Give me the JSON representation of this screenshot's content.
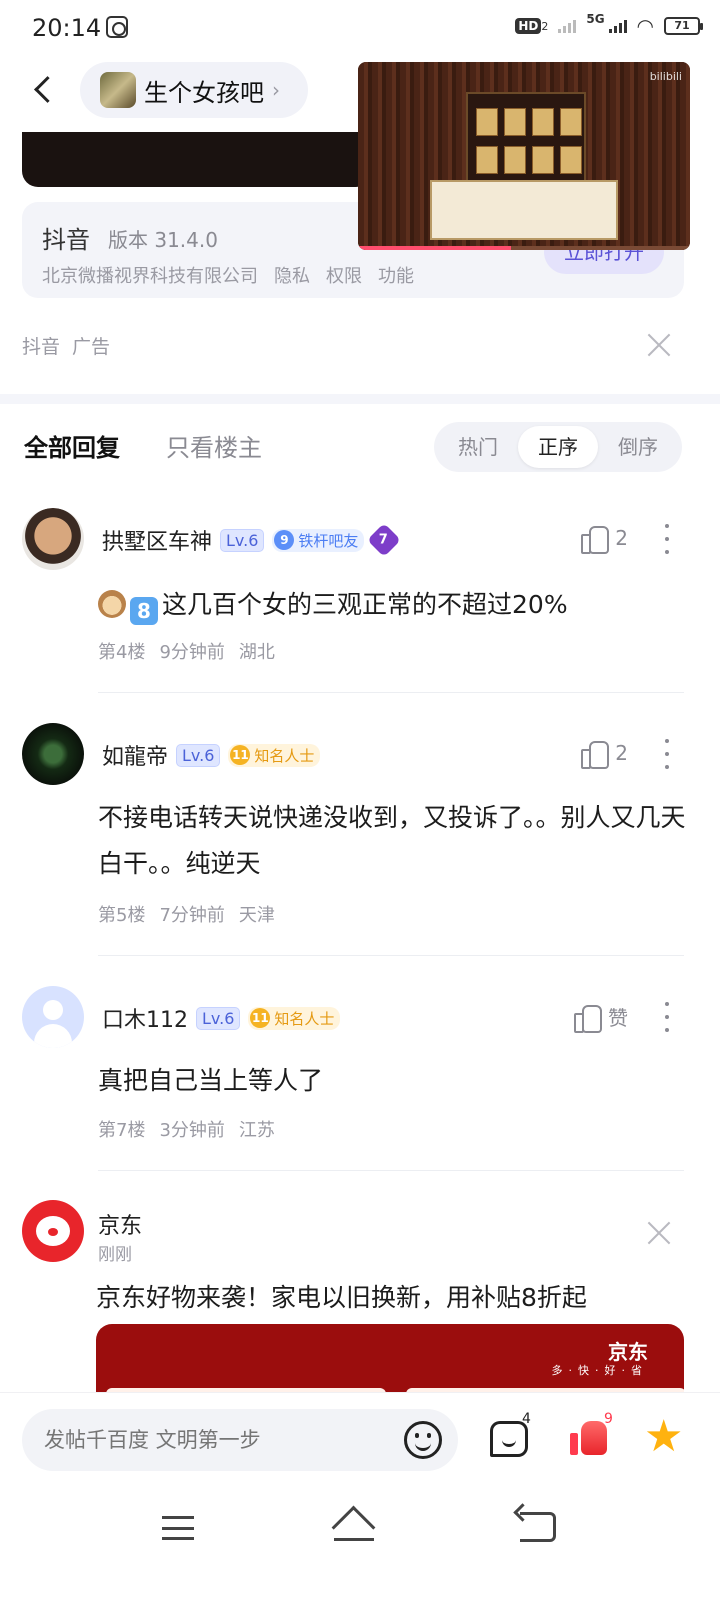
{
  "status_bar": {
    "time": "20:14",
    "hd_label": "HD",
    "hd_sub": "2",
    "network": "5G",
    "battery": "71"
  },
  "header": {
    "forum_name": "生个女孩吧"
  },
  "video_pip": {
    "watermark": "bilibili",
    "progress": 0.46
  },
  "ad": {
    "app_name": "抖音",
    "version": "版本 31.4.0",
    "company": "北京微播视界科技有限公司",
    "links": [
      "隐私",
      "权限",
      "功能"
    ],
    "open_button": "立即打开",
    "footer": [
      "抖音",
      "广告"
    ]
  },
  "tabs": {
    "all_replies": "全部回复",
    "only_op": "只看楼主",
    "sort_options": [
      "热门",
      "正序",
      "倒序"
    ],
    "active_sort": "正序"
  },
  "comments": [
    {
      "name": "拱墅区车神",
      "level": "Lv.6",
      "tag_num": "9",
      "tag_label": "铁杆吧友",
      "extra_badge": "7",
      "likes": "2",
      "text": "这几百个女的三观正常的不超过20%",
      "floor": "第4楼",
      "time": "9分钟前",
      "location": "湖北"
    },
    {
      "name": "如龍帝",
      "level": "Lv.6",
      "tag_num": "11",
      "tag_label": "知名人士",
      "likes": "2",
      "text": "不接电话转天说快递没收到，又投诉了。。别人又几天白干。。纯逆天",
      "floor": "第5楼",
      "time": "7分钟前",
      "location": "天津"
    },
    {
      "name": "口木112",
      "level": "Lv.6",
      "tag_num": "11",
      "tag_label": "知名人士",
      "likes": "赞",
      "text": "真把自己当上等人了",
      "floor": "第7楼",
      "time": "3分钟前",
      "location": "江苏"
    }
  ],
  "jd_ad": {
    "name": "京东",
    "time": "刚刚",
    "text": "京东好物来袭！家电以旧换新，用补贴8折起",
    "logo": "京东",
    "slogan": "多·快·好·省"
  },
  "bottom_bar": {
    "input_placeholder": "发帖千百度 文明第一步",
    "comment_count": "4",
    "like_count": "9"
  }
}
